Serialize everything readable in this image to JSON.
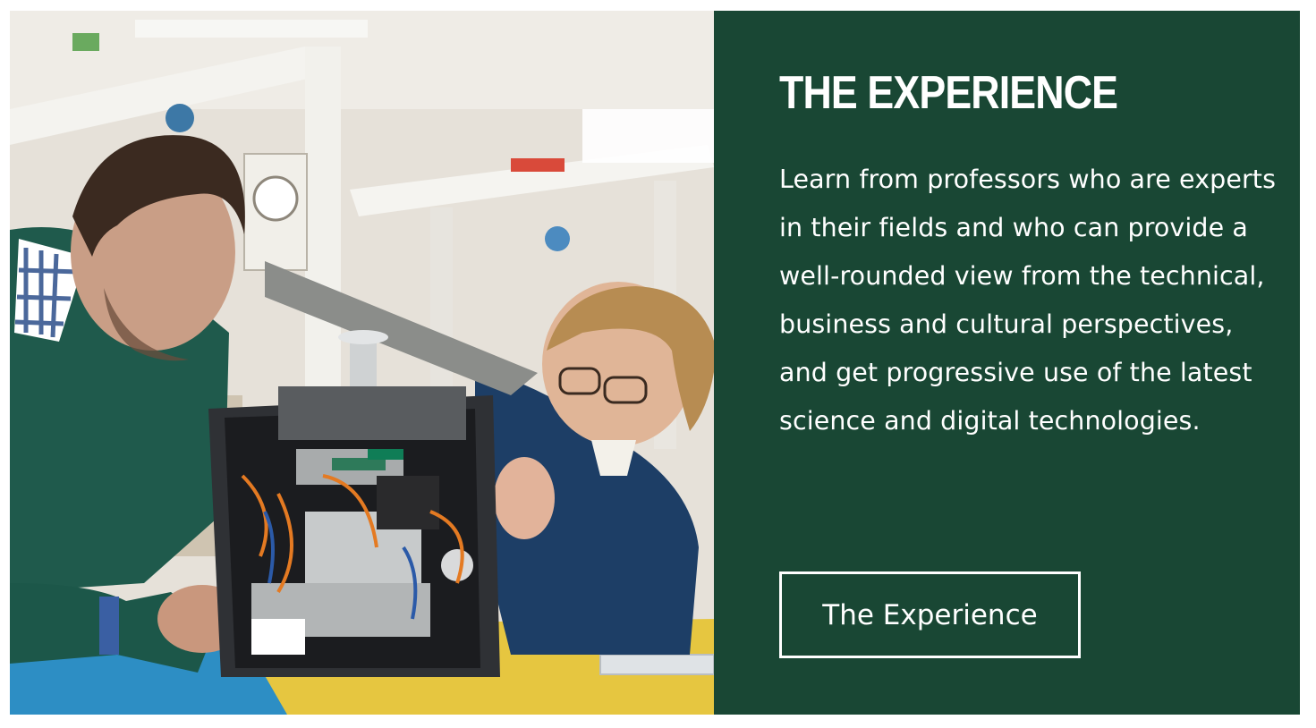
{
  "section": {
    "heading": "THE EXPERIENCE",
    "body": "Learn from professors who are experts in their fields and who can provide a well-rounded view from the technical, business and cultural perspectives, and get progressive use of the latest science and digital technologies.",
    "button_label": "The Experience"
  },
  "colors": {
    "panel_background": "#194734",
    "text": "#ffffff",
    "button_border": "#ffffff"
  },
  "photo": {
    "subject": "two students repairing an opened printer in an engineering lab"
  }
}
